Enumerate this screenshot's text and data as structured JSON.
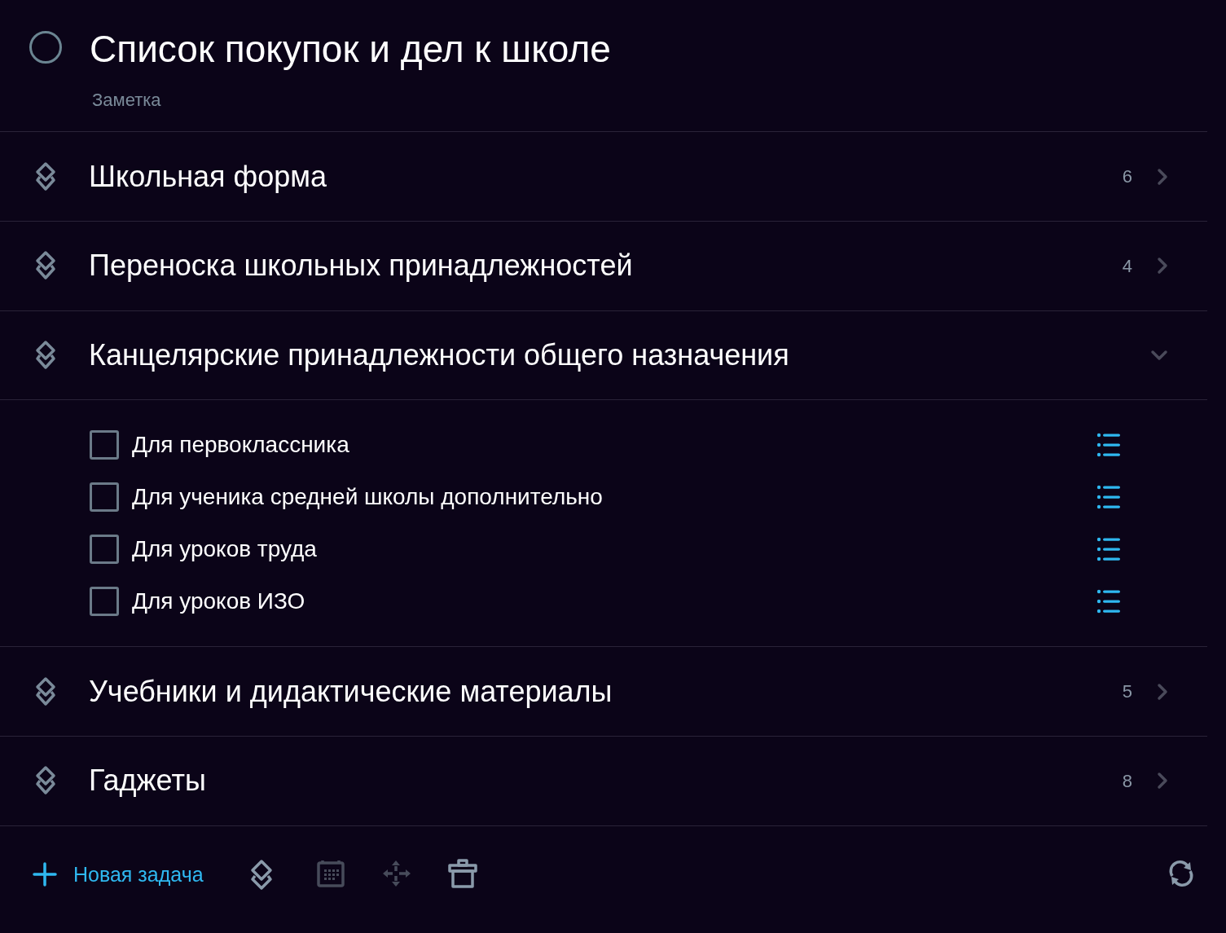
{
  "header": {
    "title": "Список покупок и дел к школе",
    "subtitle": "Заметка",
    "completed": false
  },
  "headings": [
    {
      "title": "Школьная форма",
      "count": "6",
      "expanded": false
    },
    {
      "title": "Переноска школьных принадлежностей",
      "count": "4",
      "expanded": false
    },
    {
      "title": "Канцелярские принадлежности общего назначения",
      "expanded": true,
      "tasks": [
        {
          "title": "Для первоклассника",
          "checked": false
        },
        {
          "title": "Для ученика средней школы дополнительно",
          "checked": false
        },
        {
          "title": "Для уроков труда",
          "checked": false
        },
        {
          "title": "Для уроков ИЗО",
          "checked": false
        }
      ]
    },
    {
      "title": "Учебники и дидактические материалы",
      "count": "5",
      "expanded": false
    },
    {
      "title": "Гаджеты",
      "count": "8",
      "expanded": false
    }
  ],
  "toolbar": {
    "new_task": "Новая задача",
    "tools": [
      {
        "kind": "heading",
        "disabled": false
      },
      {
        "kind": "calendar",
        "disabled": true
      },
      {
        "kind": "move",
        "disabled": true
      },
      {
        "kind": "trash",
        "disabled": false
      },
      {
        "kind": "repeat",
        "disabled": false
      }
    ]
  }
}
